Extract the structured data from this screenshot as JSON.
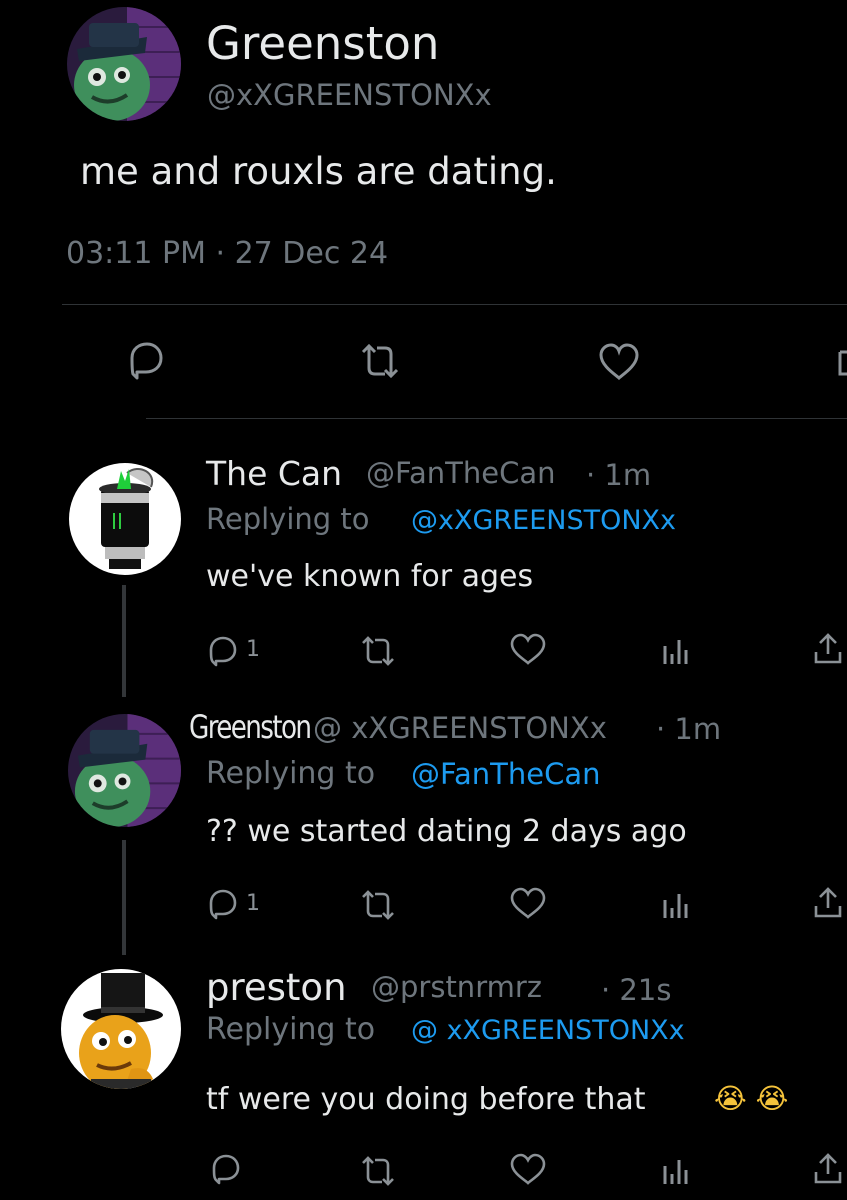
{
  "main_tweet": {
    "name": "Greenston",
    "handle": "@xXGREENSTONXx",
    "text": "me and rouxls are dating.",
    "timestamp": "03:11 PM · 27 Dec 24"
  },
  "replies": [
    {
      "name": "The Can",
      "handle": "@FanTheCan",
      "time": "· 1m",
      "replying_prefix": "Replying to",
      "replying_to": "@xXGREENSTONXx",
      "text": "we've known for ages",
      "reply_count": "1"
    },
    {
      "name": "Greenston",
      "handle": "@ xXGREENSTONXx",
      "time": "· 1m",
      "replying_prefix": "Replying to",
      "replying_to": "@FanTheCan",
      "text": "?? we started dating 2 days ago",
      "reply_count": "1"
    },
    {
      "name": "preston",
      "handle": "@prstnrmrz",
      "time": "· 21s",
      "replying_prefix": "Replying to",
      "replying_to": "@ xXGREENSTONXx",
      "text": "tf were you doing before that",
      "emoji": "😭 😭"
    }
  ],
  "icons": [
    "reply-icon",
    "retweet-icon",
    "like-icon",
    "analytics-icon",
    "share-icon"
  ],
  "colors": {
    "background": "#000000",
    "text": "#e7e9ea",
    "muted": "#6e767d",
    "link": "#1d9bf0"
  }
}
